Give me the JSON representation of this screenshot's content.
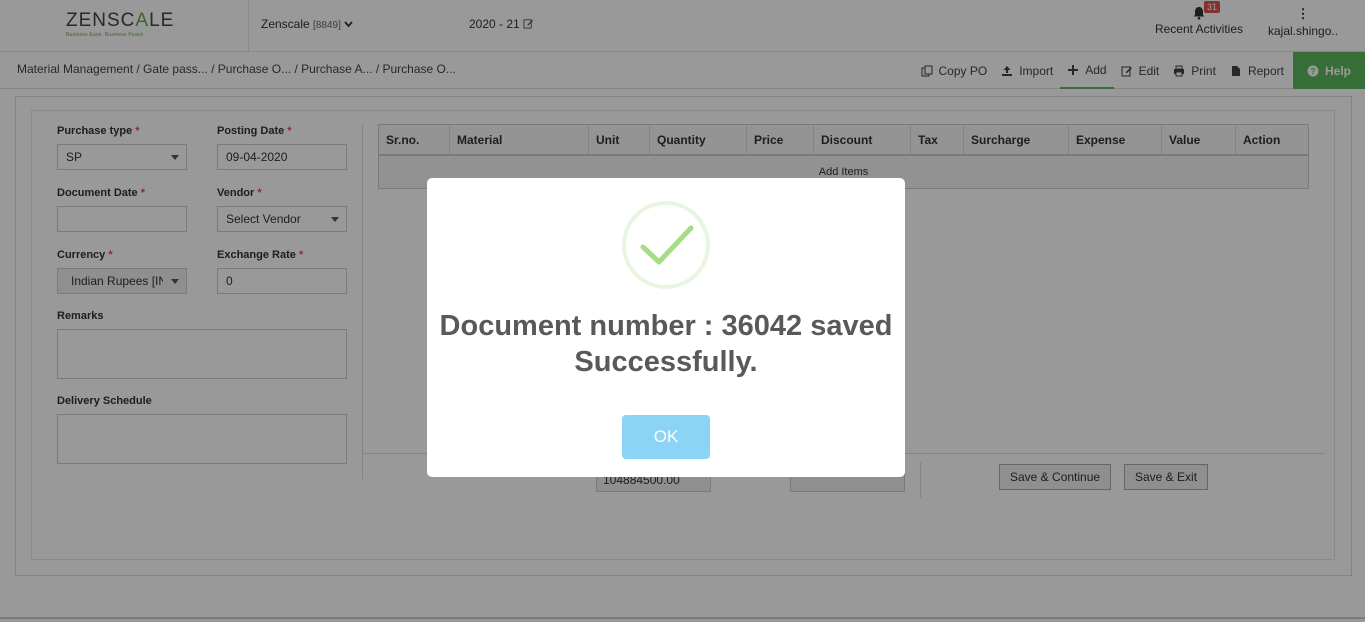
{
  "header": {
    "logo_text_a": "ZENSC",
    "logo_text_b": "A",
    "logo_text_c": "LE",
    "logo_tagline": "Business Ease. Business Peace.",
    "company_name": "Zenscale",
    "company_code": "[8849]",
    "fiscal_year": "2020 - 21",
    "notification_count": "31",
    "recent_activities": "Recent Activities",
    "user_name": "kajal.shingo.."
  },
  "breadcrumb": "Material Management  / Gate pass... / Purchase O... / Purchase A... / Purchase O...",
  "toolbar": {
    "copy_po": "Copy PO",
    "import": "Import",
    "add": "Add",
    "edit": "Edit",
    "print": "Print",
    "report": "Report",
    "help": "Help"
  },
  "form": {
    "purchase_type_label": "Purchase type",
    "purchase_type_value": "SP",
    "posting_date_label": "Posting Date",
    "posting_date_value": "09-04-2020",
    "document_date_label": "Document Date",
    "document_date_value": "",
    "vendor_label": "Vendor",
    "vendor_value": "Select Vendor",
    "currency_label": "Currency",
    "currency_value": "Indian Rupees [IN",
    "exchange_rate_label": "Exchange Rate",
    "exchange_rate_value": "0",
    "remarks_label": "Remarks",
    "delivery_schedule_label": "Delivery Schedule",
    "required_mark": "*"
  },
  "items_table": {
    "columns": [
      "Sr.no.",
      "Material",
      "Unit",
      "Quantity",
      "Price",
      "Discount",
      "Tax",
      "Surcharge",
      "Expense",
      "Value",
      "Action"
    ],
    "add_items": "Add Items"
  },
  "footer": {
    "total_value": "104884500.00",
    "save_continue": "Save & Continue",
    "save_exit": "Save & Exit"
  },
  "modal": {
    "message": "Document number : 36042 saved Successfully.",
    "ok_label": "OK",
    "icon": "success-check-icon"
  },
  "colors": {
    "accent_green": "#5cb85c",
    "ok_button": "#8cd4f5",
    "check_green": "#a5dc86"
  }
}
